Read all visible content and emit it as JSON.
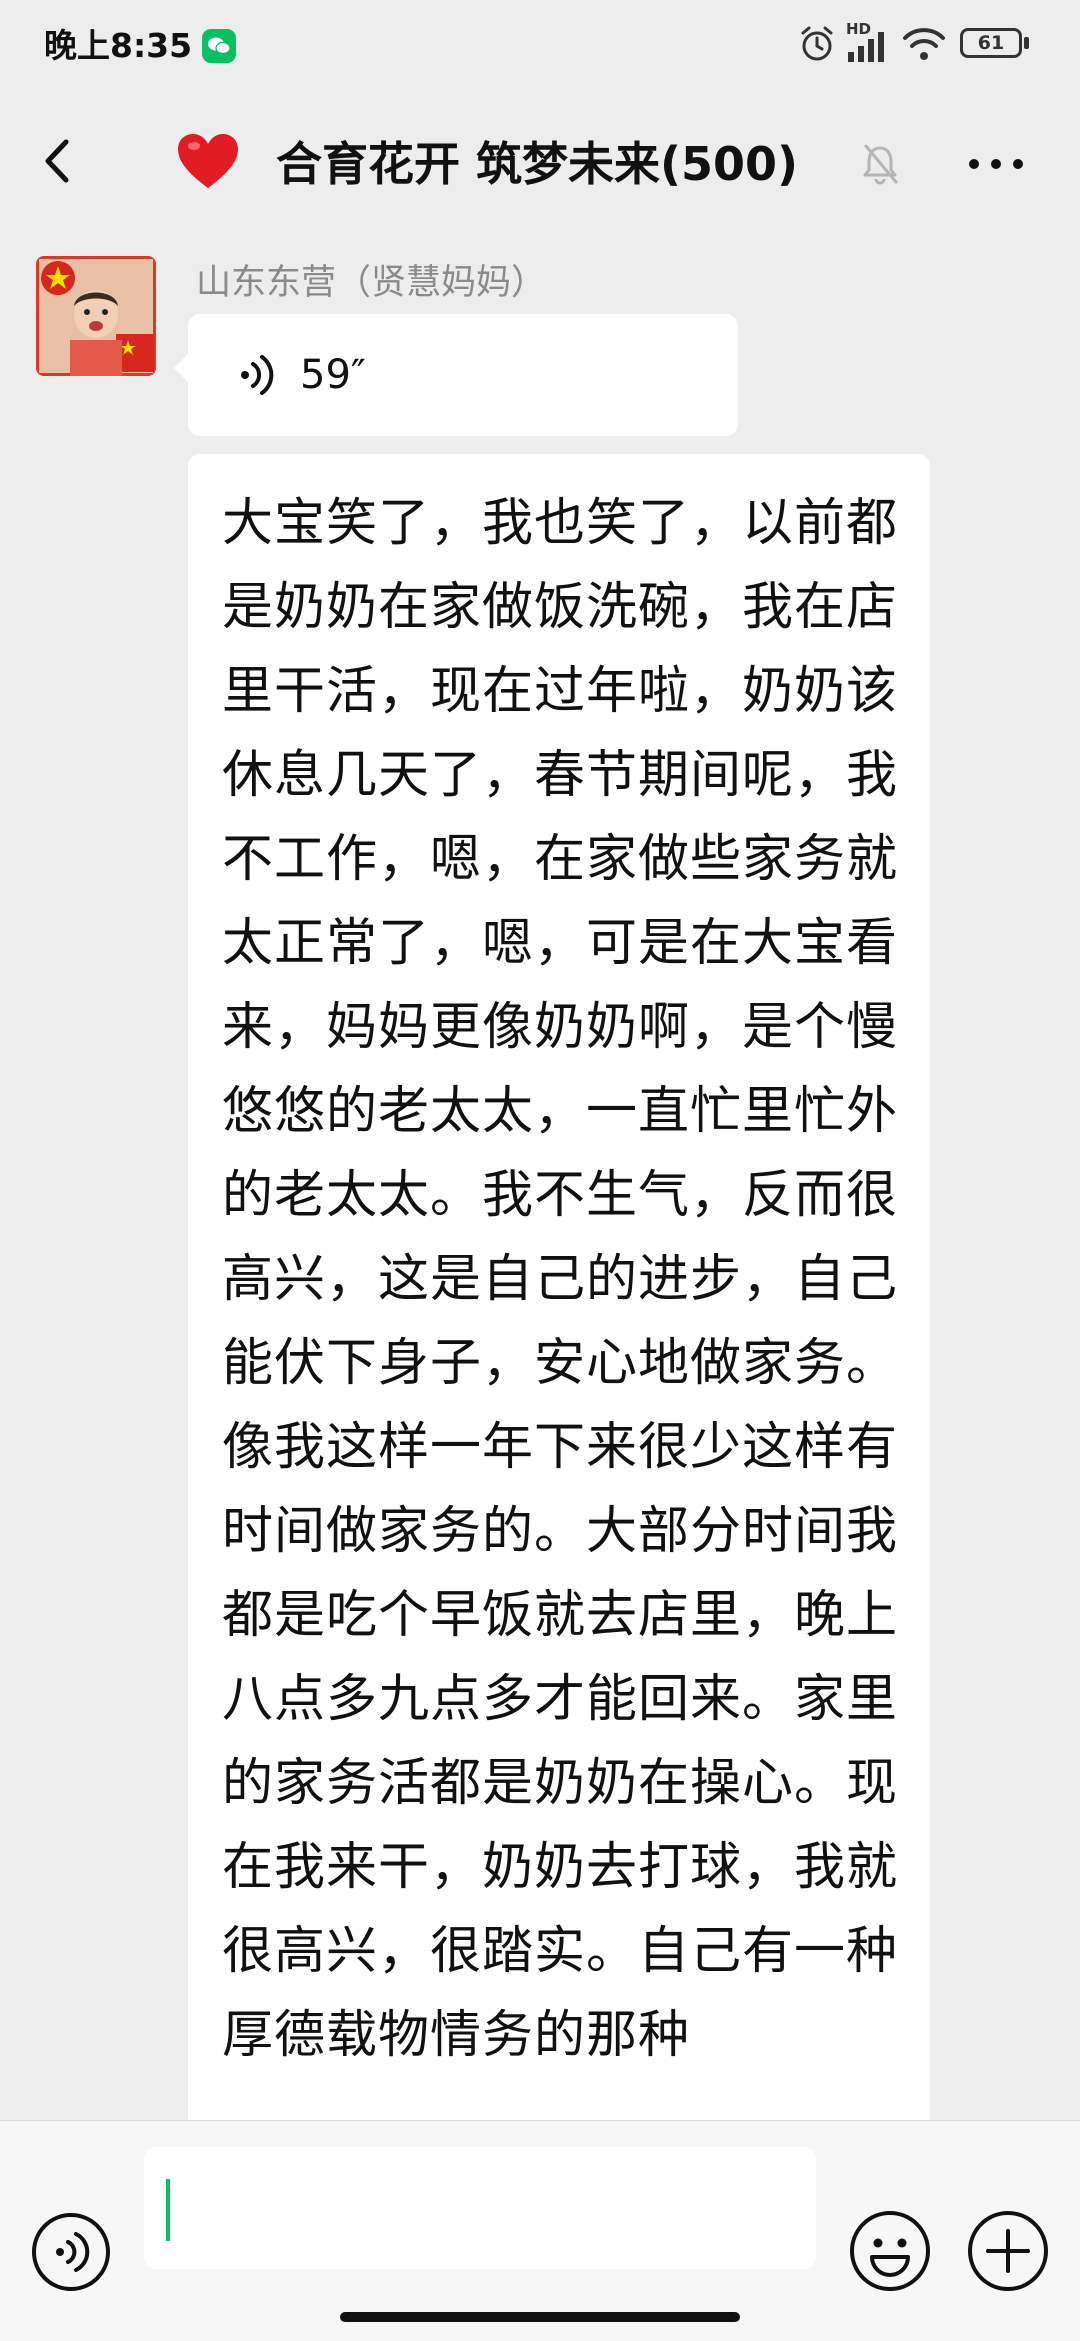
{
  "status_bar": {
    "time": "晚上8:35",
    "battery": "61",
    "network": "HD"
  },
  "header": {
    "back_icon": "chevron-left-icon",
    "title_emoji": "heart-icon",
    "title": "合育花开 筑梦未来(500)",
    "mute_icon": "bell-off-icon",
    "more_icon": "more-dots-icon"
  },
  "messages": [
    {
      "sender": "山东东营（贤慧妈妈）",
      "type": "voice",
      "duration": "59″"
    },
    {
      "type": "text",
      "text": "大宝笑了，我也笑了，以前都是奶奶在家做饭洗碗，我在店里干活，现在过年啦，奶奶该休息几天了，春节期间呢，我不工作，嗯，在家做些家务就太正常了，嗯，可是在大宝看来，妈妈更像奶奶啊，是个慢悠悠的老太太，一直忙里忙外的老太太。我不生气，反而很高兴，这是自己的进步，自己能伏下身子，安心地做家务。像我这样一年下来很少这样有时间做家务的。大部分时间我都是吃个早饭就去店里，晚上八点多九点多才能回来。家里的家务活都是奶奶在操心。现在我来干，奶奶去打球，我就很高兴，很踏实。自己有一种厚德载物情务的那种"
    }
  ],
  "input_bar": {
    "voice_icon": "voice-toggle-icon",
    "emoji_icon": "emoji-icon",
    "add_icon": "plus-icon"
  },
  "colors": {
    "background": "#ededed",
    "bubble": "#ffffff",
    "accent": "#07c160",
    "heart": "#e31b23"
  }
}
